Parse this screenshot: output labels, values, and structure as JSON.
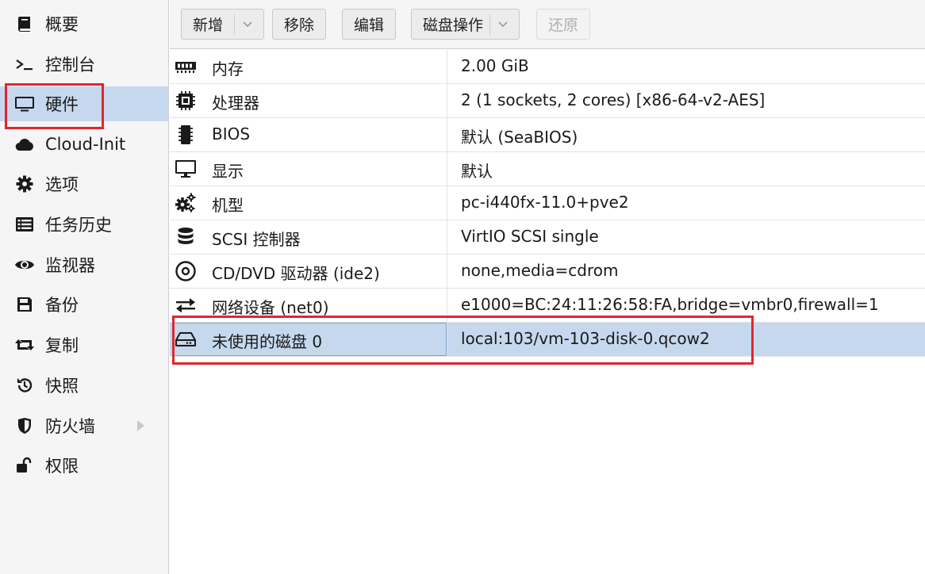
{
  "sidebar": {
    "items": [
      {
        "label": "概要",
        "icon": "book-icon"
      },
      {
        "label": "控制台",
        "icon": "terminal-icon"
      },
      {
        "label": "硬件",
        "icon": "monitor-icon",
        "selected": true
      },
      {
        "label": "Cloud-Init",
        "icon": "cloud-icon"
      },
      {
        "label": "选项",
        "icon": "gear-icon"
      },
      {
        "label": "任务历史",
        "icon": "list-icon"
      },
      {
        "label": "监视器",
        "icon": "eye-icon"
      },
      {
        "label": "备份",
        "icon": "floppy-disk-icon"
      },
      {
        "label": "复制",
        "icon": "retweet-icon"
      },
      {
        "label": "快照",
        "icon": "history-icon"
      },
      {
        "label": "防火墙",
        "icon": "shield-icon",
        "has_submenu": true
      },
      {
        "label": "权限",
        "icon": "unlock-icon"
      }
    ]
  },
  "toolbar": {
    "add_label": "新增",
    "remove_label": "移除",
    "edit_label": "编辑",
    "disk_action_label": "磁盘操作",
    "revert_label": "还原"
  },
  "hardware": {
    "rows": [
      {
        "name": "内存",
        "value": "2.00 GiB",
        "icon": "memory-icon"
      },
      {
        "name": "处理器",
        "value": "2 (1 sockets, 2 cores) [x86-64-v2-AES]",
        "icon": "cpu-icon"
      },
      {
        "name": "BIOS",
        "value": "默认 (SeaBIOS)",
        "icon": "microchip-icon"
      },
      {
        "name": "显示",
        "value": "默认",
        "icon": "desktop-icon"
      },
      {
        "name": "机型",
        "value": "pc-i440fx-11.0+pve2",
        "icon": "cogs-icon"
      },
      {
        "name": "SCSI 控制器",
        "value": "VirtIO SCSI single",
        "icon": "database-icon"
      },
      {
        "name": "CD/DVD 驱动器 (ide2)",
        "value": "none,media=cdrom",
        "icon": "cdrom-icon"
      },
      {
        "name": "网络设备 (net0)",
        "value": "e1000=BC:24:11:26:58:FA,bridge=vmbr0,firewall=1",
        "icon": "exchange-icon"
      },
      {
        "name": "未使用的磁盘 0",
        "value": "local:103/vm-103-disk-0.qcow2",
        "icon": "hdd-icon",
        "selected": true
      }
    ]
  },
  "colors": {
    "selection": "#c5d8ee",
    "highlight_box": "#e0262f"
  }
}
